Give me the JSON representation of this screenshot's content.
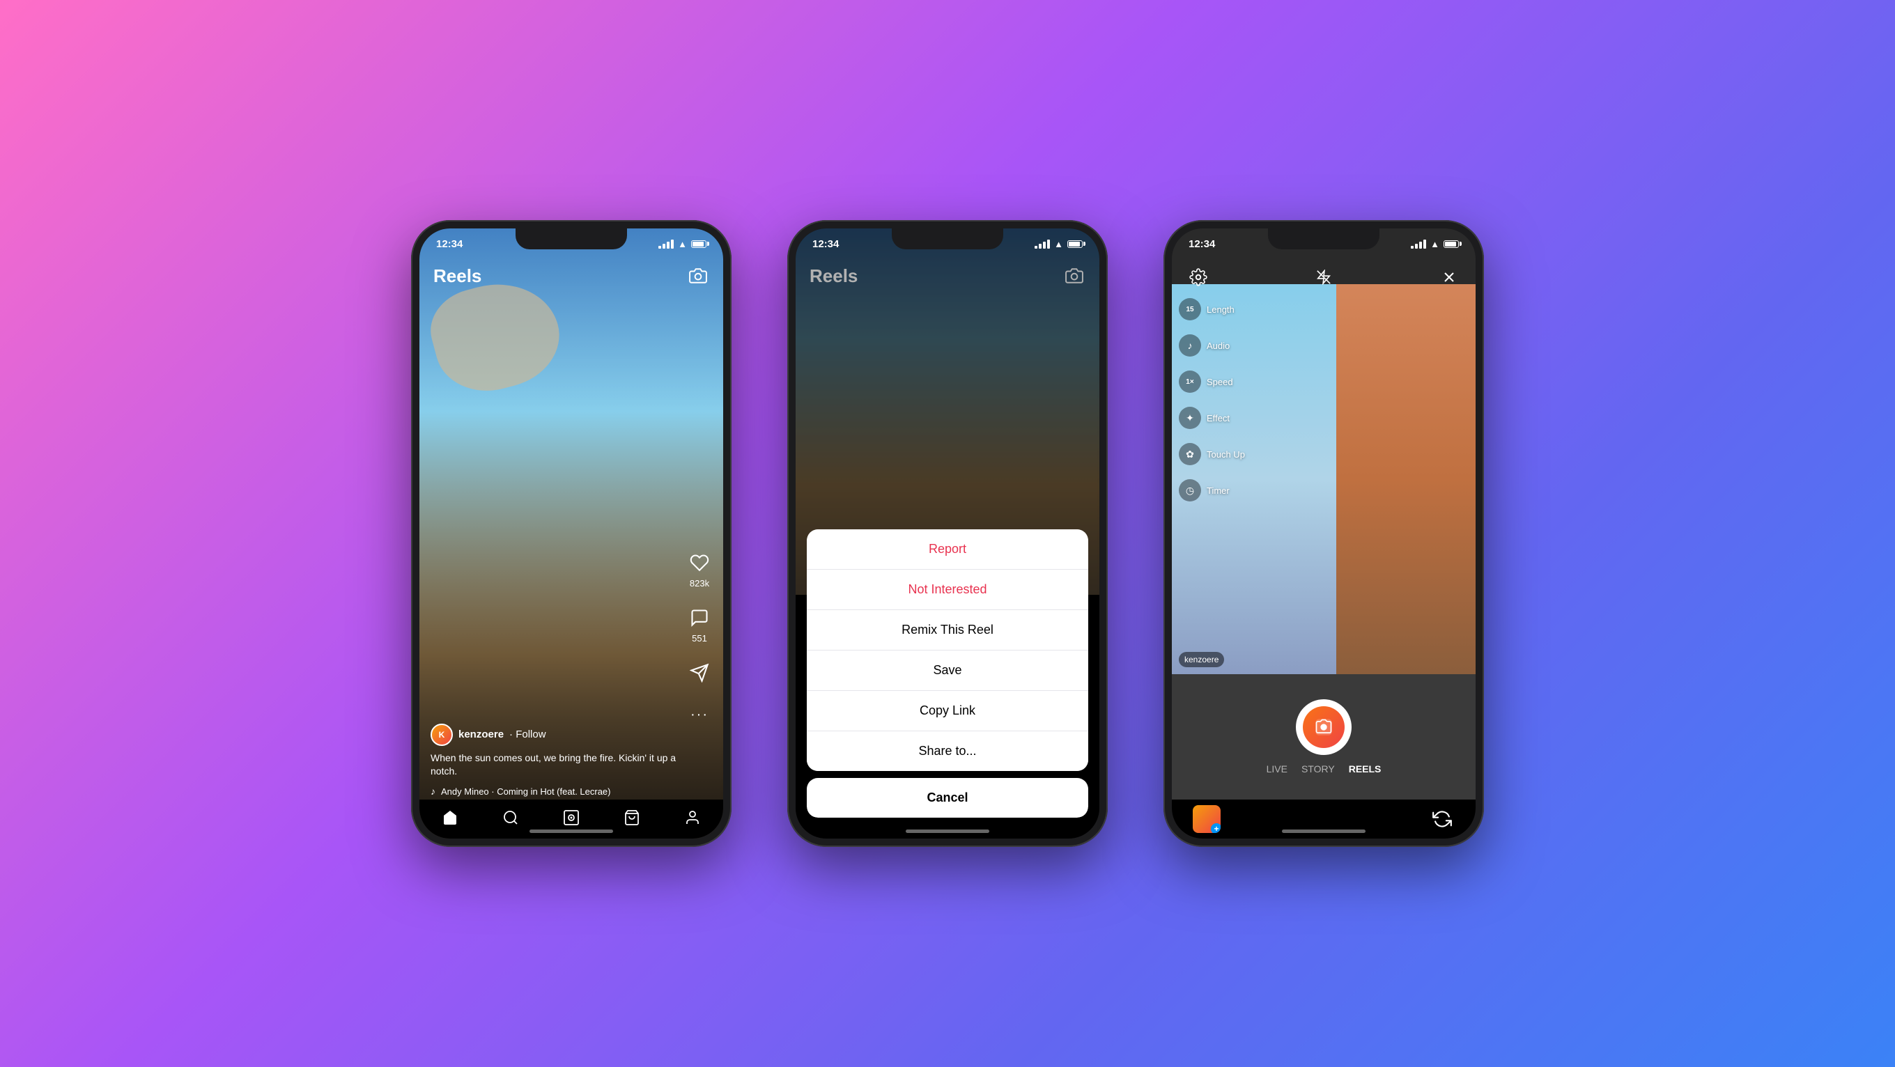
{
  "background": "linear-gradient(135deg, #ff6ec7 0%, #a855f7 40%, #6366f1 70%, #3b82f6 100%)",
  "phone1": {
    "statusBar": {
      "time": "12:34",
      "signal": true,
      "wifi": true,
      "battery": true
    },
    "header": {
      "title": "Reels",
      "cameraIcon": "camera"
    },
    "rightActions": {
      "likeCount": "823k",
      "commentCount": "551"
    },
    "userInfo": {
      "username": "kenzoere",
      "followLabel": "· Follow",
      "caption": "When the sun comes out, we bring the fire.\nKickin' it up a notch.",
      "audio": "Andy Mineo · Coming in Hot (feat. Lecrae)"
    },
    "nav": {
      "homeIcon": "home",
      "searchIcon": "search",
      "reelsIcon": "reels",
      "shopIcon": "bag",
      "profileIcon": "person"
    }
  },
  "phone2": {
    "statusBar": {
      "time": "12:34"
    },
    "header": {
      "title": "Reels",
      "cameraIcon": "camera"
    },
    "actionSheet": {
      "items": [
        {
          "label": "Report",
          "style": "red"
        },
        {
          "label": "Not Interested",
          "style": "red"
        },
        {
          "label": "Remix This Reel",
          "style": "normal"
        },
        {
          "label": "Save",
          "style": "normal"
        },
        {
          "label": "Copy Link",
          "style": "normal"
        },
        {
          "label": "Share to...",
          "style": "normal"
        }
      ],
      "cancelLabel": "Cancel"
    }
  },
  "phone3": {
    "statusBar": {
      "time": "12:34"
    },
    "header": {
      "settingsIcon": "settings",
      "flashIcon": "flash-off",
      "closeIcon": "close"
    },
    "tools": [
      {
        "icon": "15",
        "label": "Length"
      },
      {
        "icon": "♪",
        "label": "Audio"
      },
      {
        "icon": "1×",
        "label": "Speed"
      },
      {
        "icon": "✦",
        "label": "Effect"
      },
      {
        "icon": "✿",
        "label": "Touch Up"
      },
      {
        "icon": "◷",
        "label": "Timer"
      }
    ],
    "leftUsername": "kenzoere",
    "modes": [
      {
        "label": "LIVE",
        "active": false
      },
      {
        "label": "STORY",
        "active": false
      },
      {
        "label": "REELS",
        "active": true
      }
    ]
  }
}
